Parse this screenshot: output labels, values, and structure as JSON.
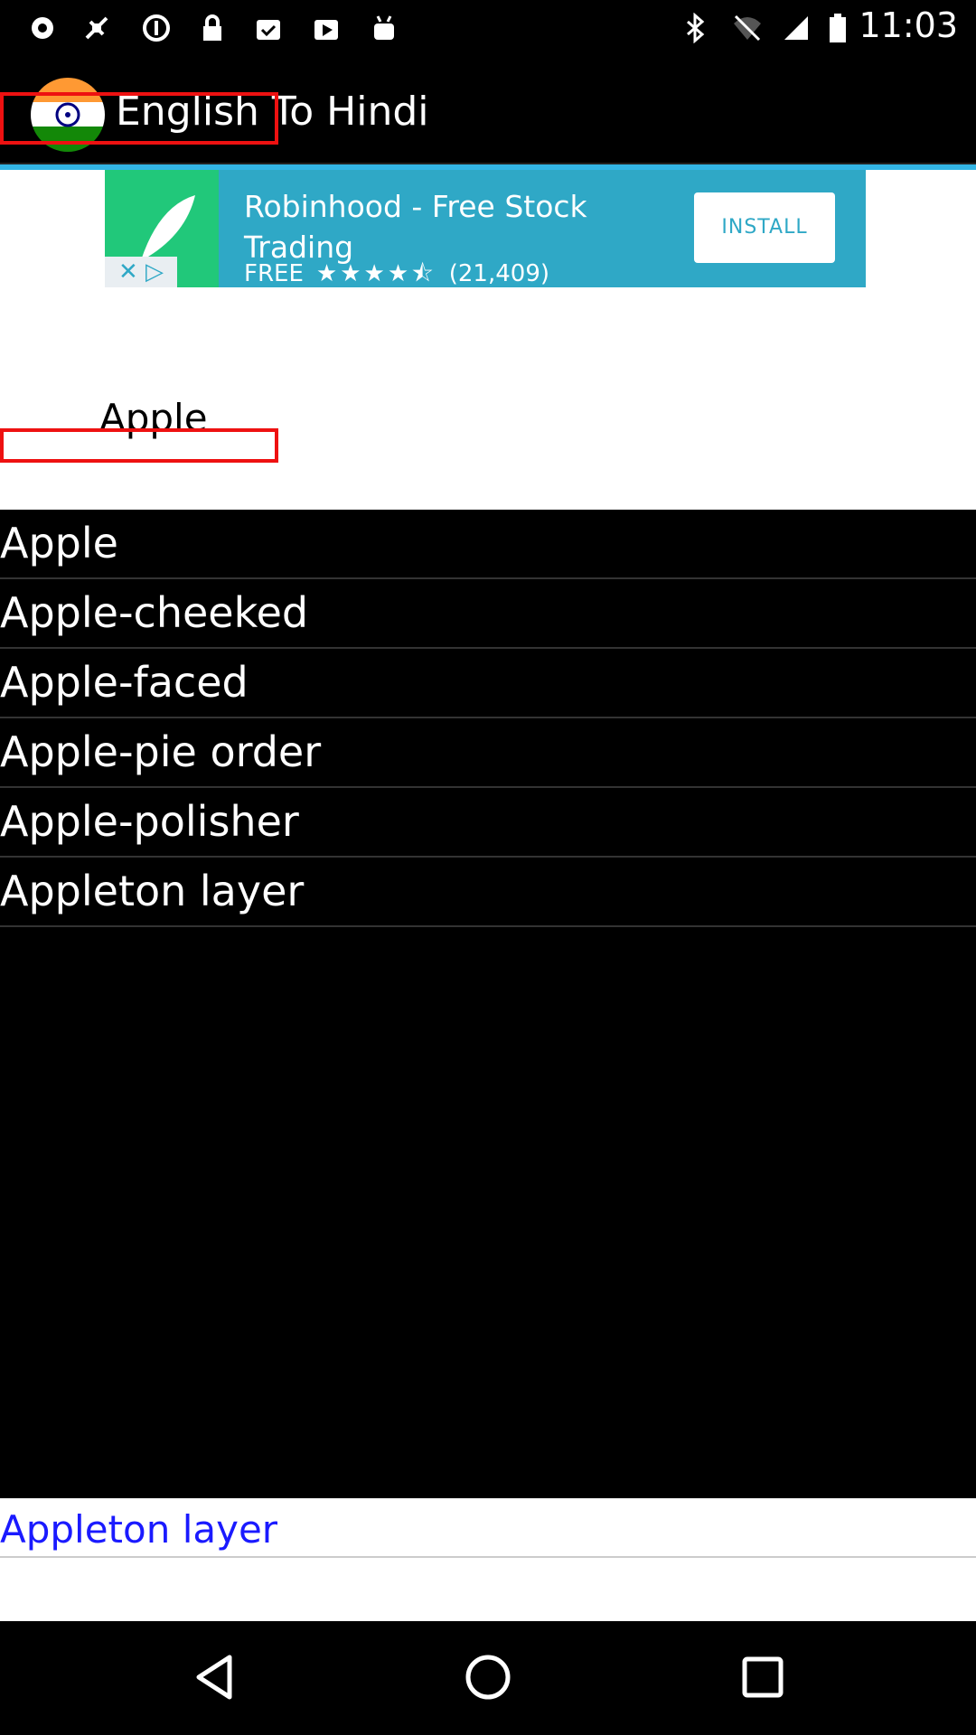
{
  "status_bar": {
    "time": "11:03",
    "icons": [
      "record-icon",
      "fake-gps-icon",
      "info-icon",
      "lock-icon",
      "clipboard-check-icon",
      "play-store-icon",
      "android-icon",
      "bluetooth-icon",
      "wifi-off-icon",
      "cell-signal-icon",
      "battery-icon"
    ]
  },
  "app_bar": {
    "title": "English To Hindi",
    "logo_icon": "india-flag-icon"
  },
  "ad": {
    "title": "Robinhood - Free Stock Trading",
    "price": "FREE",
    "stars": "★★★★⯪",
    "rating_count": "(21,409)",
    "install_label": "INSTALL",
    "close_icon": "close-adchoices-icon"
  },
  "search": {
    "value": "Apple"
  },
  "suggestions": [
    "Apple",
    "Apple-cheeked",
    "Apple-faced",
    "Apple-pie order",
    "Apple-polisher",
    "Appleton layer"
  ],
  "result": {
    "word": "Appleton layer"
  },
  "colors": {
    "accent": "#33b5e5",
    "ad_background": "#2fa8c6",
    "result_link": "#1a1aff",
    "highlight_outline": "#e11111"
  }
}
